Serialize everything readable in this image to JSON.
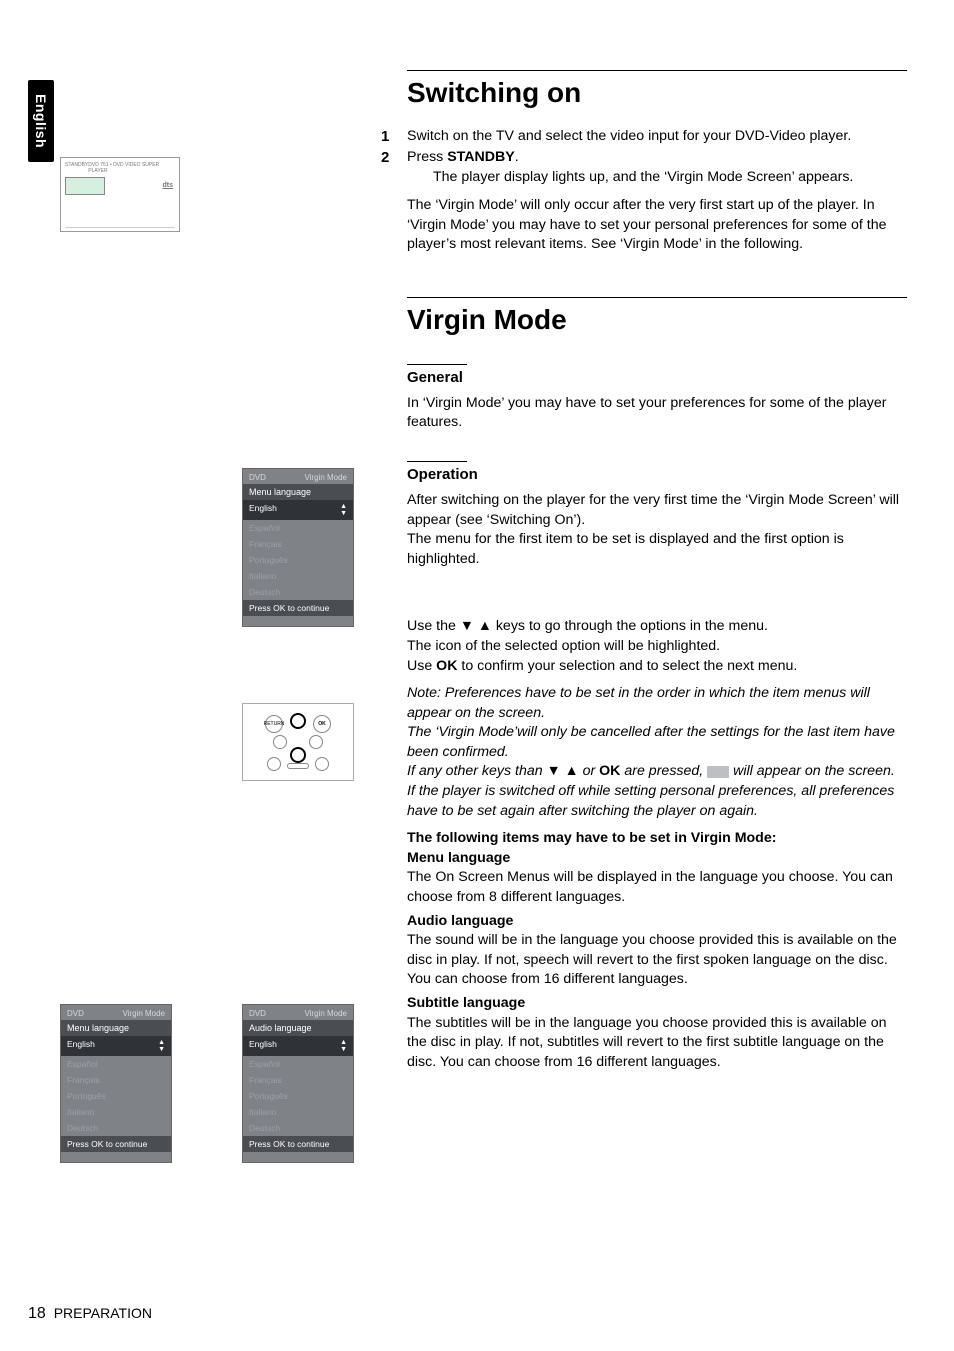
{
  "side_tab": "English",
  "section1": {
    "heading": "Switching on",
    "step1": "Switch on the TV and select the video input for your DVD-Video player.",
    "step2_lead": "Press ",
    "step2_bold": "STANDBY",
    "step2_tail": ".",
    "step2_sub": "The player display lights up, and the ‘Virgin Mode Screen’ appears.",
    "para": "The ‘Virgin Mode’ will only occur after the very first start up of the player. In ‘Virgin Mode’ you may have to set your personal preferences for some of the player’s most relevant items. See ‘Virgin Mode’ in the following."
  },
  "section2": {
    "heading": "Virgin Mode",
    "general_h": "General",
    "general_p": "In ‘Virgin Mode’ you may have to set your preferences for some of the player features.",
    "operation_h": "Operation",
    "op_p1": "After switching on the player for the very first time the ‘Virgin Mode Screen’ will appear (see ‘Switching On’).",
    "op_p2": "The menu for the first item to be set is displayed and the first option is highlighted.",
    "use1_a": "Use the ",
    "use1_b": " keys to go through the options in the menu.",
    "use2": "The icon of the selected option will be highlighted.",
    "use3_a": "Use ",
    "use3_ok": "OK",
    "use3_b": " to confirm your selection and to select the next menu.",
    "note1": "Note: Preferences have to be set in the order in which the item menus will appear on the screen.",
    "note2": "The ‘Virgin Mode’will only be cancelled after the settings for the last item have been confirmed.",
    "note3_a": "If any other keys than ",
    "note3_b": " or ",
    "note3_ok": "OK",
    "note3_c": " are pressed, ",
    "note3_d": " will appear on the screen.",
    "note4": "If the player is switched off while setting personal preferences, all preferences have to be set again after switching the player on again.",
    "items_h": "The following items may have to be set in Virgin Mode:",
    "menu_lang_h": "Menu language",
    "menu_lang_p": "The On Screen Menus will be displayed in the language you choose. You can choose from 8   different languages.",
    "audio_lang_h": "Audio language",
    "audio_lang_p": "The sound will be in the language you choose provided this is available on the disc in play. If not, speech will revert to the first spoken language on the disc. You can choose from 16 different languages.",
    "sub_lang_h": "Subtitle language",
    "sub_lang_p": "The subtitles will be in the language you choose provided this is available on the disc in play. If not, subtitles will revert to the first subtitle language on the disc. You can choose from 16 different languages."
  },
  "osd": {
    "logo": "DVD",
    "mode": "Virgin Mode",
    "menu_sec": "Menu language",
    "audio_sec": "Audio language",
    "opts": [
      "English",
      "Español",
      "Français",
      "Português",
      "Italiano",
      "Deutsch"
    ],
    "foot": "Press OK to continue"
  },
  "remote": {
    "return": "RETURN",
    "ok": "OK"
  },
  "device": {
    "stby": "STANDBY",
    "dts": "dts"
  },
  "footer": {
    "page": "18",
    "label": "PREPARATION"
  }
}
